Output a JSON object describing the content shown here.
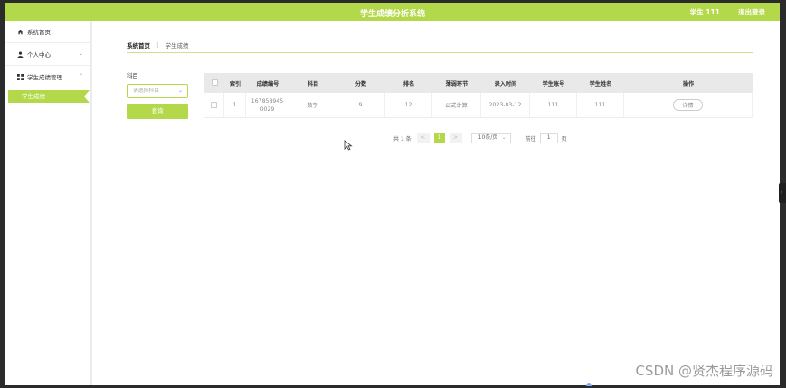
{
  "header": {
    "title": "学生成绩分析系统",
    "user": "学生 111",
    "logout_label": "退出登录"
  },
  "sidebar": {
    "items": [
      {
        "label": "系统首页",
        "icon": "home-icon"
      },
      {
        "label": "个人中心",
        "icon": "user-icon"
      },
      {
        "label": "学生成绩管理",
        "icon": "grid-icon"
      }
    ],
    "sub_item": "学生成绩"
  },
  "breadcrumb": {
    "home": "系统首页",
    "separator": "⋮",
    "current": "学生成绩"
  },
  "filter": {
    "label": "科目",
    "placeholder": "请选择科目",
    "query_label": "查询"
  },
  "table": {
    "headers": [
      "索引",
      "成绩编号",
      "科目",
      "分数",
      "排名",
      "薄弱环节",
      "录入时间",
      "学生账号",
      "学生姓名",
      "操作"
    ],
    "rows": [
      {
        "index": "1",
        "id": "1678589450029",
        "subject": "数学",
        "score": "9",
        "rank": "12",
        "weakness": "公式计算",
        "time": "2023-03-12",
        "account": "111",
        "name": "111",
        "action": "详情"
      }
    ]
  },
  "pager": {
    "total": "共 1 条",
    "prev": "<",
    "current_page": "1",
    "next": ">",
    "page_size": "10条/页",
    "goto_label": "前往",
    "goto_value": "1",
    "page_suffix": "页"
  },
  "watermark": "CSDN @贤杰程序源码",
  "colors": {
    "accent": "#b3d94a",
    "header_bg": "#e9e9e9"
  }
}
